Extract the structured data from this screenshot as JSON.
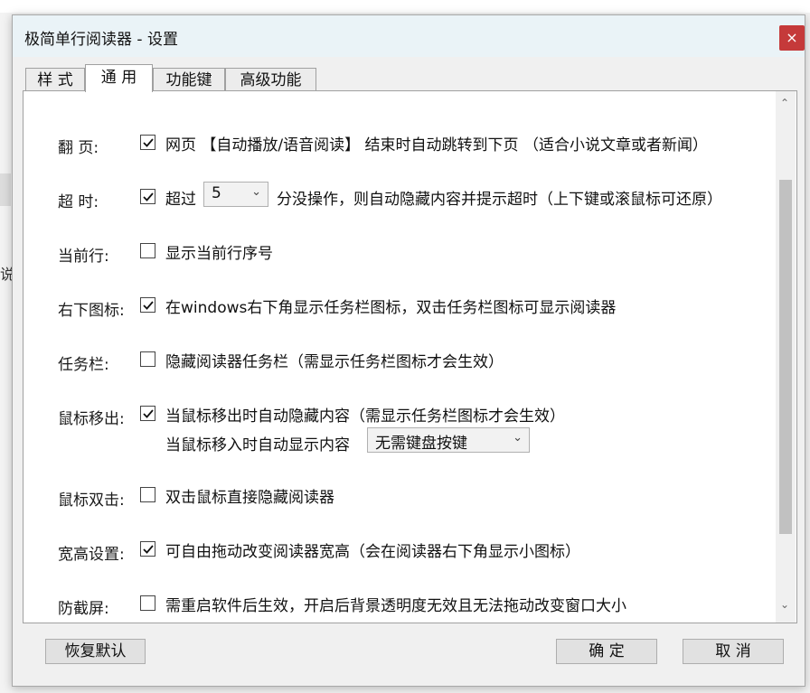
{
  "background": {
    "partial_text": "说"
  },
  "window": {
    "title": "极简单行阅读器 - 设置",
    "close_label": "×"
  },
  "tabs": [
    {
      "label": "样 式",
      "active": false
    },
    {
      "label": "通 用",
      "active": true
    },
    {
      "label": "功能键",
      "active": false
    },
    {
      "label": "高级功能",
      "active": false
    }
  ],
  "settings": {
    "page_turn": {
      "label": "翻 页:",
      "checked": true,
      "text": "网页 【自动播放/语音阅读】 结束时自动跳转到下页 （适合小说文章或者新闻）"
    },
    "timeout": {
      "label": "超 时:",
      "checked": true,
      "text_before": "超过",
      "value": "5",
      "text_after": "分没操作，则自动隐藏内容并提示超时（上下键或滚鼠标可还原）"
    },
    "current_line": {
      "label": "当前行:",
      "checked": false,
      "text": "显示当前行序号"
    },
    "tray_icon": {
      "label": "右下图标:",
      "checked": true,
      "text": "在windows右下角显示任务栏图标，双击任务栏图标可显示阅读器"
    },
    "taskbar": {
      "label": "任务栏:",
      "checked": false,
      "text": "隐藏阅读器任务栏（需显示任务栏图标才会生效）"
    },
    "mouse_out": {
      "label": "鼠标移出:",
      "checked": true,
      "text": "当鼠标移出时自动隐藏内容（需显示任务栏图标才会生效）",
      "sub_text": "当鼠标移入时自动显示内容",
      "sub_value": "无需键盘按键"
    },
    "double_click": {
      "label": "鼠标双击:",
      "checked": false,
      "text": "双击鼠标直接隐藏阅读器"
    },
    "resize": {
      "label": "宽高设置:",
      "checked": true,
      "text": "可自由拖动改变阅读器宽高（会在阅读器右下角显示小图标）"
    },
    "anti_capture": {
      "label": "防截屏:",
      "checked": false,
      "text": "需重启软件后生效，开启后背景透明度无效且无法拖动改变窗口大小"
    }
  },
  "buttons": {
    "restore_default": "恢复默认",
    "ok": "确 定",
    "cancel": "取 消"
  },
  "icons": {
    "close": "close-icon",
    "check": "check-icon",
    "dropdown": "chevron-down-icon",
    "scroll_up": "chevron-up-icon",
    "scroll_down": "chevron-down-icon"
  },
  "colors": {
    "title_bar": "#eaf3f7",
    "close_button": "#c53a3a",
    "panel": "#ffffff",
    "scroll_thumb": "#c1c1c1"
  }
}
